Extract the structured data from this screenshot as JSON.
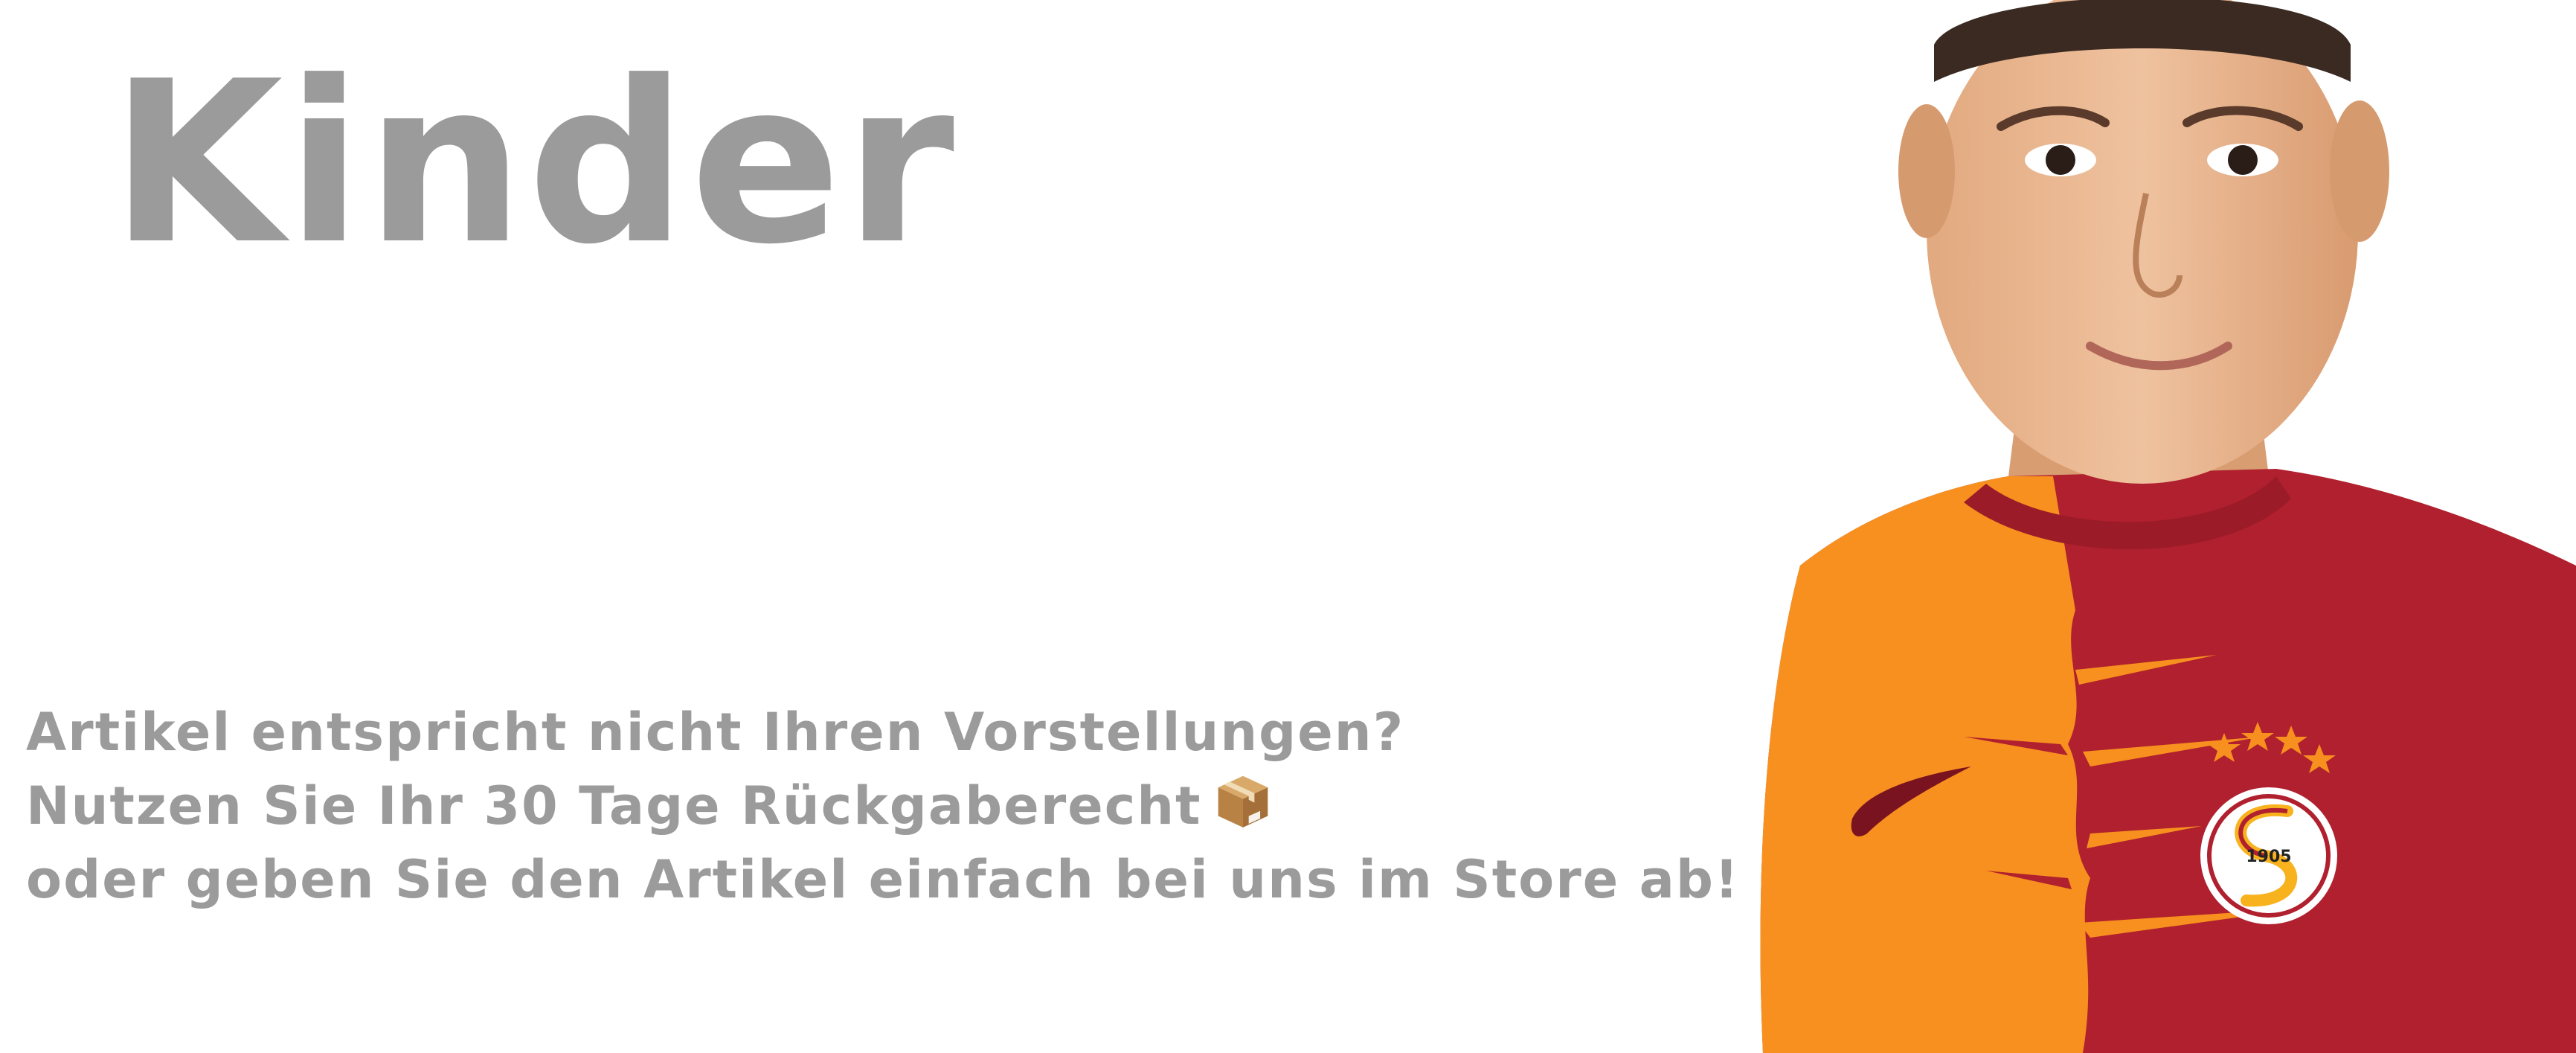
{
  "banner": {
    "title": "Kinder",
    "notice_lines": [
      "Artikel entspricht nicht Ihren Vorstellungen?",
      "Nutzen Sie Ihr 30 Tage Rückgaberecht",
      "oder geben Sie den Artikel einfach bei uns im Store ab!"
    ],
    "notice_icon": "package-box-icon"
  },
  "photo": {
    "subject": "child-in-football-jersey",
    "crest_year": "1905",
    "colors": {
      "orange": "#f7901e",
      "red": "#b0202e",
      "skin": "#e8b48c",
      "hair": "#3a2a22"
    }
  },
  "colors": {
    "text_gray": "#9b9b9b",
    "background": "#ffffff"
  }
}
